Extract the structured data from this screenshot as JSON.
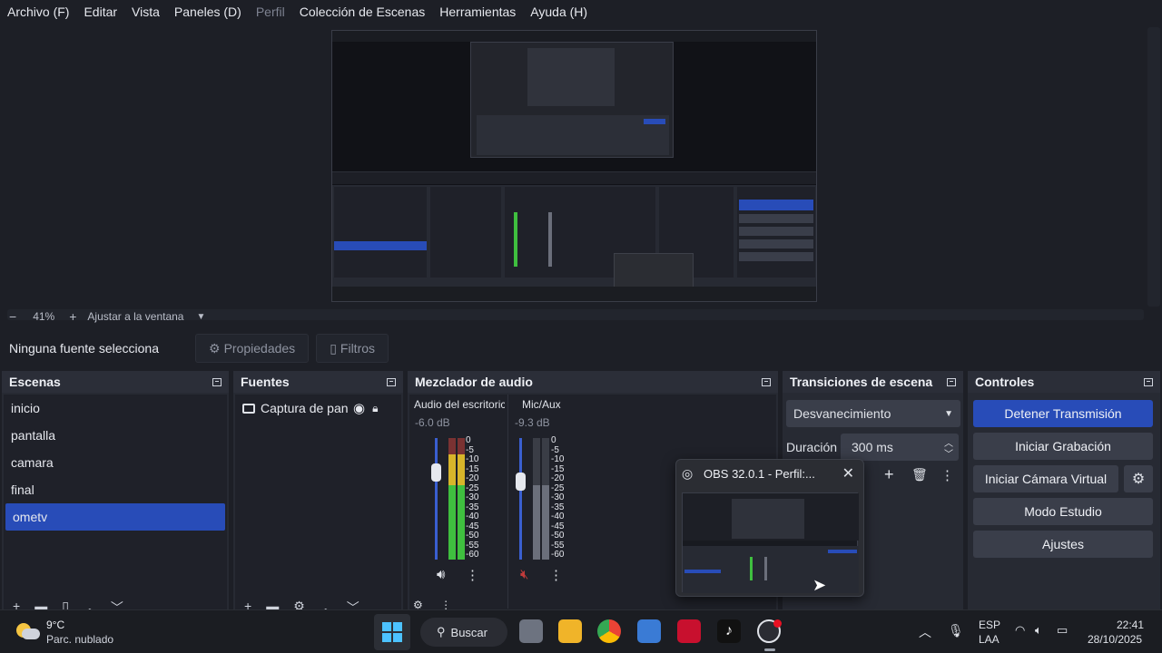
{
  "menu": {
    "items": [
      "Archivo (F)",
      "Editar",
      "Vista",
      "Paneles (D)",
      "Perfil",
      "Colección de Escenas",
      "Herramientas",
      "Ayuda (H)"
    ]
  },
  "zoom": {
    "minus": "−",
    "level": "41%",
    "plus": "+",
    "fit_label": "Ajustar a la ventana"
  },
  "source_bar": {
    "no_source": "Ninguna fuente selecciona",
    "properties": "Propiedades",
    "filters": "Filtros"
  },
  "scenes": {
    "title": "Escenas",
    "items": [
      "inicio",
      "pantalla",
      "camara",
      "final",
      "ometv"
    ],
    "selected": "ometv"
  },
  "sources": {
    "title": "Fuentes",
    "items": [
      {
        "label": "Captura de pant"
      }
    ]
  },
  "mixer": {
    "title": "Mezclador de audio",
    "channels": [
      {
        "name": "Audio del escritoric",
        "db": "-6.0 dB",
        "muted": false
      },
      {
        "name": "Mic/Aux",
        "db": "-9.3 dB",
        "muted": true
      }
    ],
    "scale": [
      "0",
      "-5",
      "-10",
      "-15",
      "-20",
      "-25",
      "-30",
      "-35",
      "-40",
      "-45",
      "-50",
      "-55",
      "-60"
    ]
  },
  "transitions": {
    "title": "Transiciones de escena",
    "selected": "Desvanecimiento",
    "duration_label": "Duración",
    "duration_value": "300 ms"
  },
  "controls": {
    "title": "Controles",
    "stop_stream": "Detener Transmisión",
    "start_recording": "Iniciar Grabación",
    "start_virtual_cam": "Iniciar Cámara Virtual",
    "studio_mode": "Modo Estudio",
    "settings": "Ajustes"
  },
  "popup": {
    "title": "OBS 32.0.1 - Perfil:..."
  },
  "taskbar": {
    "weather_temp": "9°C",
    "weather_desc": "Parc. nublado",
    "search_label": "Buscar",
    "lang_top": "ESP",
    "lang_bottom": "LAA",
    "time": "22:41",
    "date": "28/10/2025"
  },
  "colors": {
    "accent": "#284cb8",
    "background": "#1d1f26",
    "meter_green": "#3fbf3f",
    "meter_yellow": "#d7b52a",
    "meter_red": "#c23b3b"
  }
}
